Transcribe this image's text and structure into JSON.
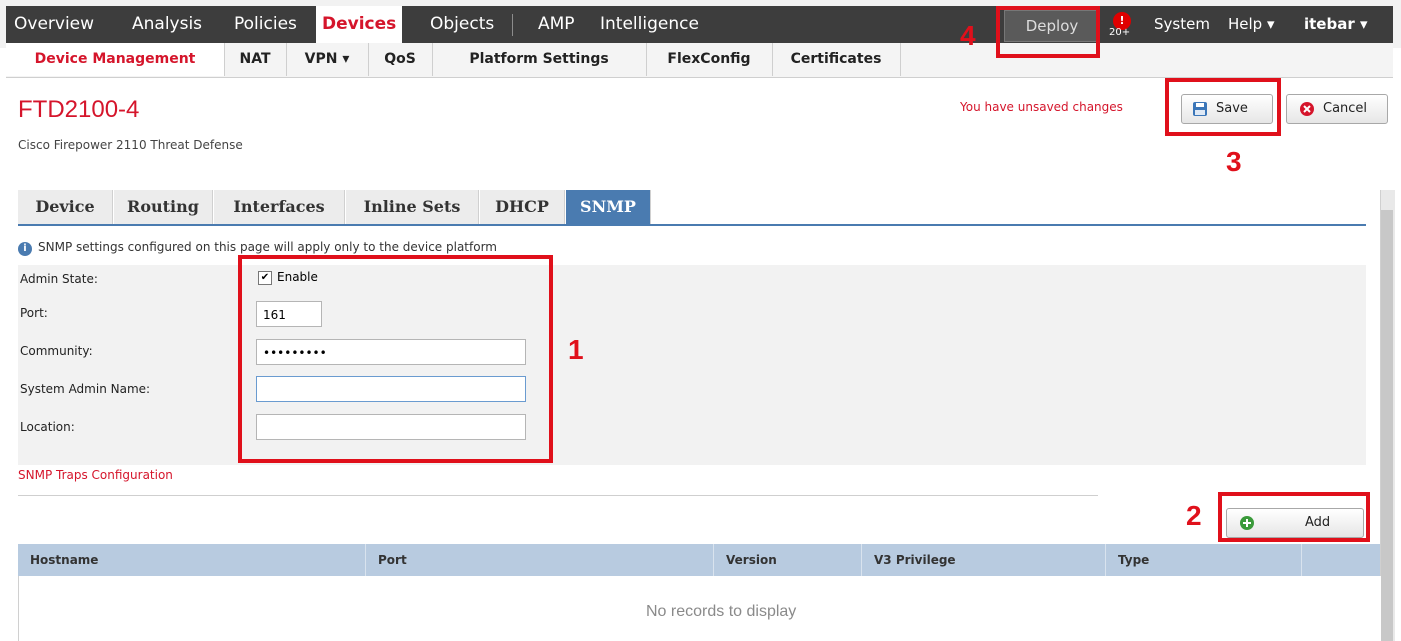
{
  "topnav": {
    "items": [
      "Overview",
      "Analysis",
      "Policies",
      "Devices",
      "Objects",
      "AMP",
      "Intelligence"
    ],
    "deploy_label": "Deploy",
    "alert_count": "20+",
    "system_label": "System",
    "help_label": "Help ▾",
    "user_label": "itebar ▾"
  },
  "subnav": {
    "items": [
      "Device Management",
      "NAT",
      "VPN ▾",
      "QoS",
      "Platform Settings",
      "FlexConfig",
      "Certificates"
    ]
  },
  "header": {
    "title": "FTD2100-4",
    "subtitle": "Cisco Firepower 2110 Threat Defense",
    "unsaved": "You have unsaved changes",
    "save_label": "Save",
    "cancel_label": "Cancel"
  },
  "tabs": [
    "Device",
    "Routing",
    "Interfaces",
    "Inline Sets",
    "DHCP",
    "SNMP"
  ],
  "snmp": {
    "info": "SNMP settings configured on this page will apply only to the device platform",
    "admin_state_label": "Admin State:",
    "enable_label": "Enable",
    "port_label": "Port:",
    "port_value": "161",
    "community_label": "Community:",
    "community_value": "•••••••••",
    "sysadmin_label": "System Admin Name:",
    "sysadmin_value": "",
    "location_label": "Location:",
    "location_value": "",
    "traps_link": "SNMP Traps Configuration",
    "add_label": "Add"
  },
  "grid": {
    "columns": [
      "Hostname",
      "Port",
      "Version",
      "V3 Privilege",
      "Type"
    ],
    "empty_text": "No records to display"
  },
  "annotations": [
    "1",
    "2",
    "3",
    "4"
  ],
  "colors": {
    "accent": "#d5152b",
    "tab_active": "#4a7bb0",
    "annotation": "#e0101b"
  }
}
